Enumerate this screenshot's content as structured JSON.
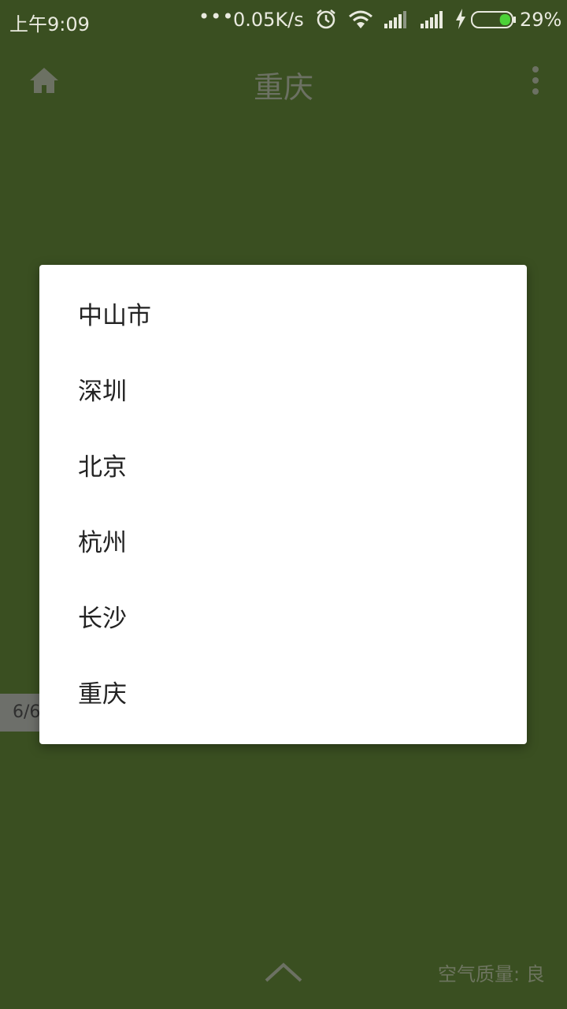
{
  "status_bar": {
    "time": "上午9:09",
    "dots": "•••",
    "speed": "0.05K/s",
    "battery_percent": "29%",
    "battery_level": 0.29,
    "icons": [
      "alarm-icon",
      "wifi-icon",
      "signal-icon",
      "signal-icon",
      "charging-icon",
      "battery-icon"
    ]
  },
  "app_bar": {
    "title": "重庆",
    "left_icon": "home-icon",
    "right_icon": "more-vert-icon"
  },
  "page_indicator": "6/6",
  "dialog": {
    "cities": [
      "中山市",
      "深圳",
      "北京",
      "杭州",
      "长沙",
      "重庆"
    ]
  },
  "bottom": {
    "chevron_icon": "chevron-up-icon",
    "air_quality": "空气质量: 良"
  },
  "colors": {
    "background": "#3a4f21",
    "dialog": "#ffffff",
    "battery_fill": "#4cd137"
  }
}
